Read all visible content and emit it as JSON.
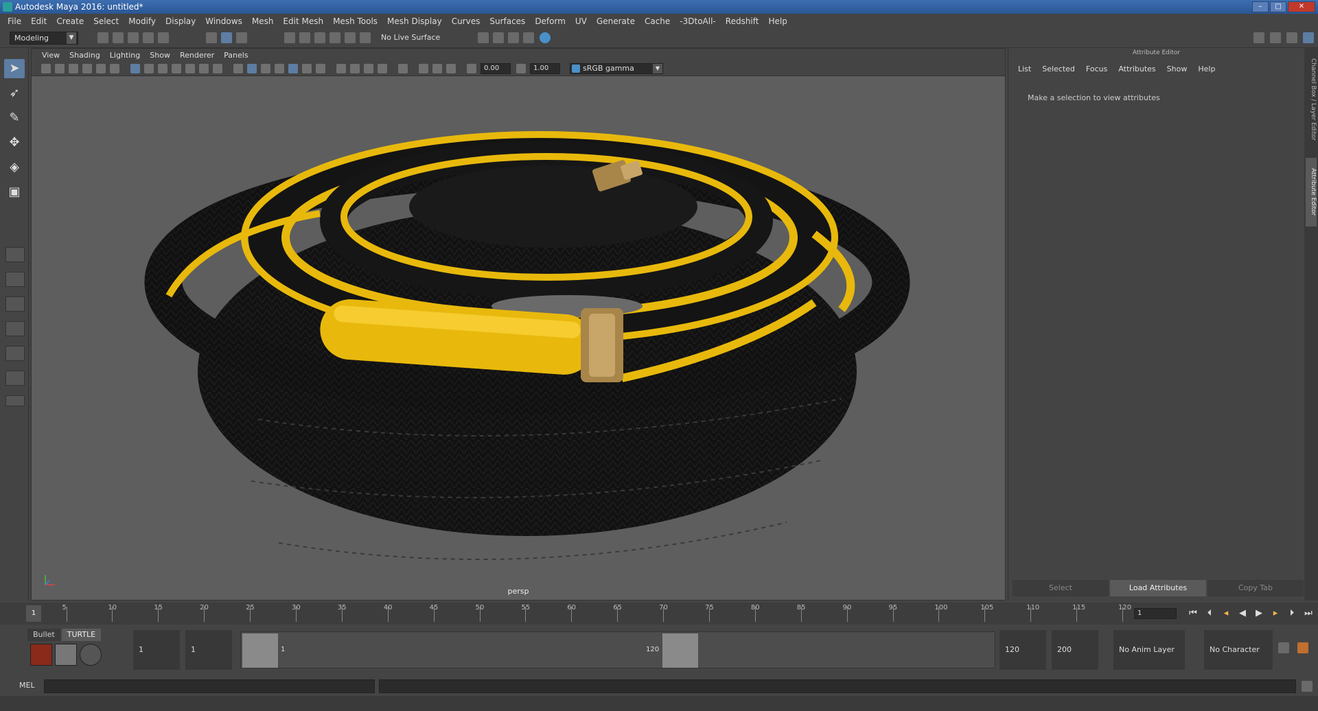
{
  "window": {
    "title": "Autodesk Maya 2016: untitled*",
    "buttons": [
      "–",
      "□",
      "✕"
    ]
  },
  "menu": [
    "File",
    "Edit",
    "Create",
    "Select",
    "Modify",
    "Display",
    "Windows",
    "Mesh",
    "Edit Mesh",
    "Mesh Tools",
    "Mesh Display",
    "Curves",
    "Surfaces",
    "Deform",
    "UV",
    "Generate",
    "Cache",
    "-3DtoAll-",
    "Redshift",
    "Help"
  ],
  "status_line": {
    "mode": "Modeling",
    "live_surface": "No Live Surface"
  },
  "viewport": {
    "menu": [
      "View",
      "Shading",
      "Lighting",
      "Show",
      "Renderer",
      "Panels"
    ],
    "exposure": "0.00",
    "gamma_value": "1.00",
    "color_space": "sRGB gamma",
    "camera": "persp"
  },
  "attribute_editor": {
    "title": "Attribute Editor",
    "menu": [
      "List",
      "Selected",
      "Focus",
      "Attributes",
      "Show",
      "Help"
    ],
    "message": "Make a selection to view attributes",
    "buttons": [
      "Select",
      "Load Attributes",
      "Copy Tab"
    ]
  },
  "side_tabs": [
    "Channel Box / Layer Editor",
    "Attribute Editor"
  ],
  "timeline": {
    "ticks": [
      "5",
      "10",
      "15",
      "20",
      "25",
      "30",
      "35",
      "40",
      "45",
      "50",
      "55",
      "60",
      "65",
      "70",
      "75",
      "80",
      "85",
      "90",
      "95",
      "100",
      "105",
      "110",
      "115",
      "120"
    ],
    "current_frame_marker": "1",
    "current_frame": "1"
  },
  "range": {
    "shelf_tabs": [
      "Bullet",
      "TURTLE"
    ],
    "start_min": "1",
    "start": "1",
    "slider_start": "1",
    "slider_end": "120",
    "end": "120",
    "end_max": "200",
    "anim_layer": "No Anim Layer",
    "character_set": "No Character Set"
  },
  "command_line": {
    "label": "MEL"
  },
  "colors": {
    "accent": "#5d7da3",
    "hose_yellow": "#e8b90c",
    "hose_black": "#141414",
    "brass": "#a8864a"
  }
}
